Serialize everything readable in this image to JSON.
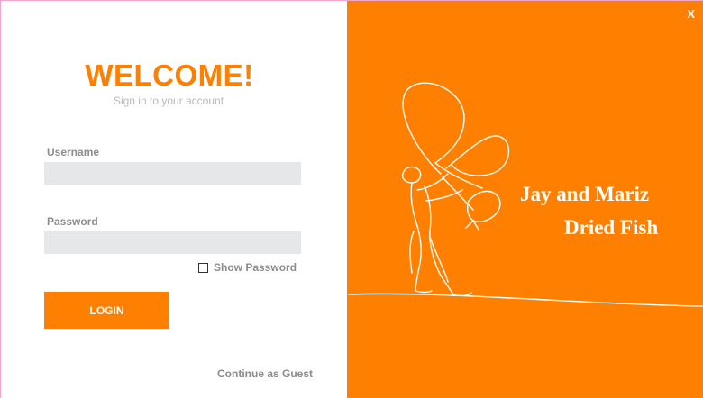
{
  "window": {
    "close_label": "X"
  },
  "login": {
    "title": "WELCOME!",
    "subtitle": "Sign in to your account",
    "username_label": "Username",
    "username_value": "",
    "password_label": "Password",
    "password_value": "",
    "show_password_label": "Show Password",
    "show_password_checked": false,
    "login_button_label": "LOGIN",
    "guest_link_label": "Continue as Guest"
  },
  "brand": {
    "line1": "Jay and Mariz",
    "line2": "Dried Fish",
    "illustration_icon": "fisherman-line-art-icon"
  },
  "colors": {
    "accent": "#ff8000",
    "input_bg": "#e6e7e9",
    "muted_text": "#8c8c8c"
  }
}
